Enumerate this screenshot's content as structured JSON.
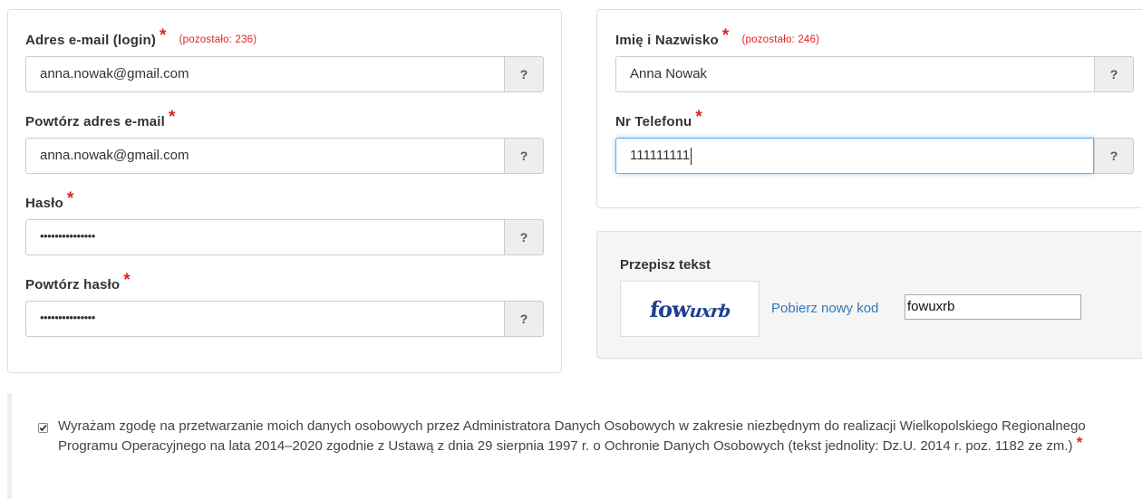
{
  "email": {
    "label": "Adres e-mail (login)",
    "required_mark": "*",
    "remaining": "(pozostało: 236)",
    "value": "anna.nowak@gmail.com",
    "help_label": "?"
  },
  "email_repeat": {
    "label": "Powtórz adres e-mail",
    "required_mark": "*",
    "value": "anna.nowak@gmail.com",
    "help_label": "?"
  },
  "password": {
    "label": "Hasło",
    "required_mark": "*",
    "value": "•••••••••••••••",
    "help_label": "?"
  },
  "password_repeat": {
    "label": "Powtórz hasło",
    "required_mark": "*",
    "value": "•••••••••••••••",
    "help_label": "?"
  },
  "full_name": {
    "label": "Imię i Nazwisko",
    "required_mark": "*",
    "remaining": "(pozostało: 246)",
    "value": "Anna Nowak",
    "help_label": "?"
  },
  "phone": {
    "label": "Nr Telefonu",
    "required_mark": "*",
    "value": "111111111",
    "help_label": "?"
  },
  "captcha": {
    "title": "Przepisz tekst",
    "image_text_a": "fow",
    "image_text_b": "uxrb",
    "refresh_link": "Pobierz nowy kod",
    "value": "fowuxrb"
  },
  "consent": {
    "checked": true,
    "text": "Wyrażam zgodę na przetwarzanie moich danych osobowych przez Administratora Danych Osobowych w zakresie niezbędnym do realizacji Wielkopolskiego Regionalnego Programu Operacyjnego na lata 2014–2020 zgodnie z Ustawą z dnia 29 sierpnia 1997 r. o Ochronie Danych Osobowych (tekst jednolity: Dz.U. 2014 r. poz. 1182 ze zm.)",
    "required_mark": "*"
  },
  "colors": {
    "required": "#e02424",
    "link": "#337ab7",
    "focus_border": "#66afe9",
    "captcha_text": "#1f3f8f"
  }
}
